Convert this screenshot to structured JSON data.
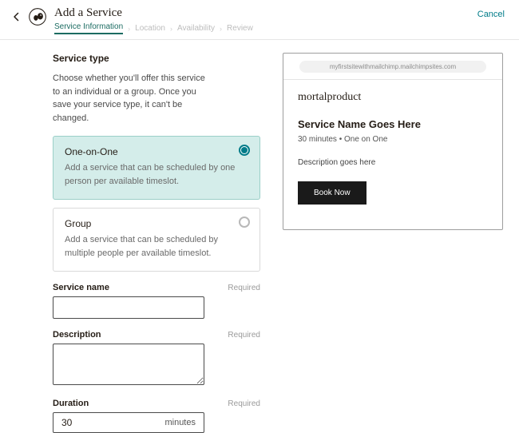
{
  "header": {
    "title": "Add a Service",
    "cancel_label": "Cancel",
    "steps": [
      "Service Information",
      "Location",
      "Availability",
      "Review"
    ],
    "active_step_index": 0
  },
  "form": {
    "service_type": {
      "heading": "Service type",
      "hint": "Choose whether you'll offer this service to an individual or a group. Once you save your service type, it can't be changed.",
      "options": [
        {
          "title": "One-on-One",
          "desc": "Add a service that can be scheduled by one person per available timeslot.",
          "selected": true
        },
        {
          "title": "Group",
          "desc": "Add a service that can be scheduled by multiple people per available timeslot.",
          "selected": false
        }
      ]
    },
    "service_name": {
      "label": "Service name",
      "required_label": "Required",
      "value": ""
    },
    "description": {
      "label": "Description",
      "required_label": "Required",
      "value": ""
    },
    "duration": {
      "label": "Duration",
      "required_label": "Required",
      "value": "30",
      "unit": "minutes"
    }
  },
  "preview": {
    "url": "myfirstsitewithmailchimp.mailchimpsites.com",
    "brand": "mortalproduct",
    "service_name": "Service Name Goes Here",
    "meta": "30 minutes • One on One",
    "description": "Description goes here",
    "cta": "Book Now"
  }
}
